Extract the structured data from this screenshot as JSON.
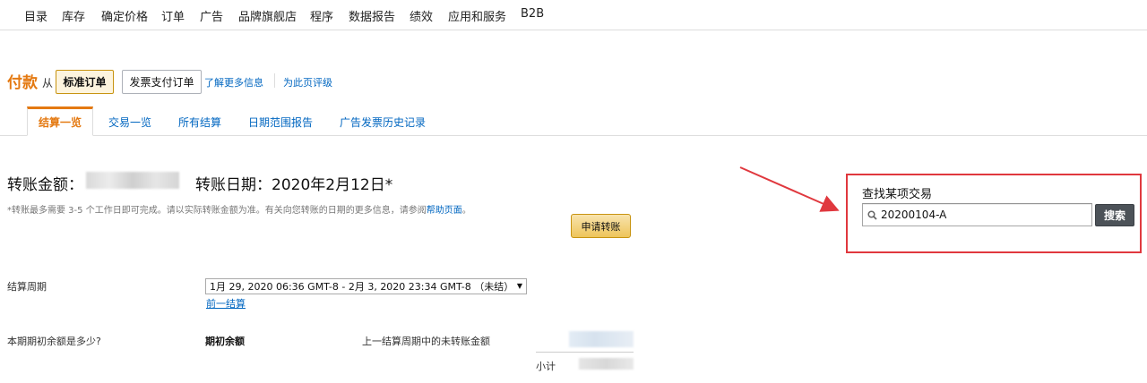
{
  "nav": [
    "目录",
    "库存",
    "确定价格",
    "订单",
    "广告",
    "品牌旗舰店",
    "程序",
    "数据报告",
    "绩效",
    "应用和服务",
    "B2B"
  ],
  "header": {
    "title": "付款",
    "from_label": "从",
    "standard_orders": "标准订单",
    "invoiced_orders": "发票支付订单",
    "learn_more": "了解更多信息",
    "rate_page": "为此页评级"
  },
  "tabs": [
    "结算一览",
    "交易一览",
    "所有结算",
    "日期范围报告",
    "广告发票历史记录"
  ],
  "transfer": {
    "amount_label": "转账金额：",
    "date_label": "转账日期：2020年2月12日*",
    "note": "*转账最多需要 3-5 个工作日即可完成。请以实际转账金额为准。有关向您转账的日期的更多信息，请参阅",
    "help_link": "帮助页面",
    "note_end": "。",
    "request_button": "申请转账"
  },
  "search": {
    "label": "查找某项交易",
    "value": "20200104-A",
    "button": "搜索"
  },
  "settlement": {
    "period_label": "结算周期",
    "period_value": "1月 29, 2020 06:36 GMT-8 - 2月 3, 2020 23:34 GMT-8 （未结）",
    "prev_link": "前一结算",
    "question": "本期期初余额是多少?",
    "opening_balance": "期初余额",
    "prev_unpaid": "上一结算周期中的未转账金额",
    "subtotal": "小计"
  },
  "colors": {
    "accent_orange": "#e47911",
    "link_blue": "#0066c0",
    "annotation_red": "#e0383e"
  }
}
